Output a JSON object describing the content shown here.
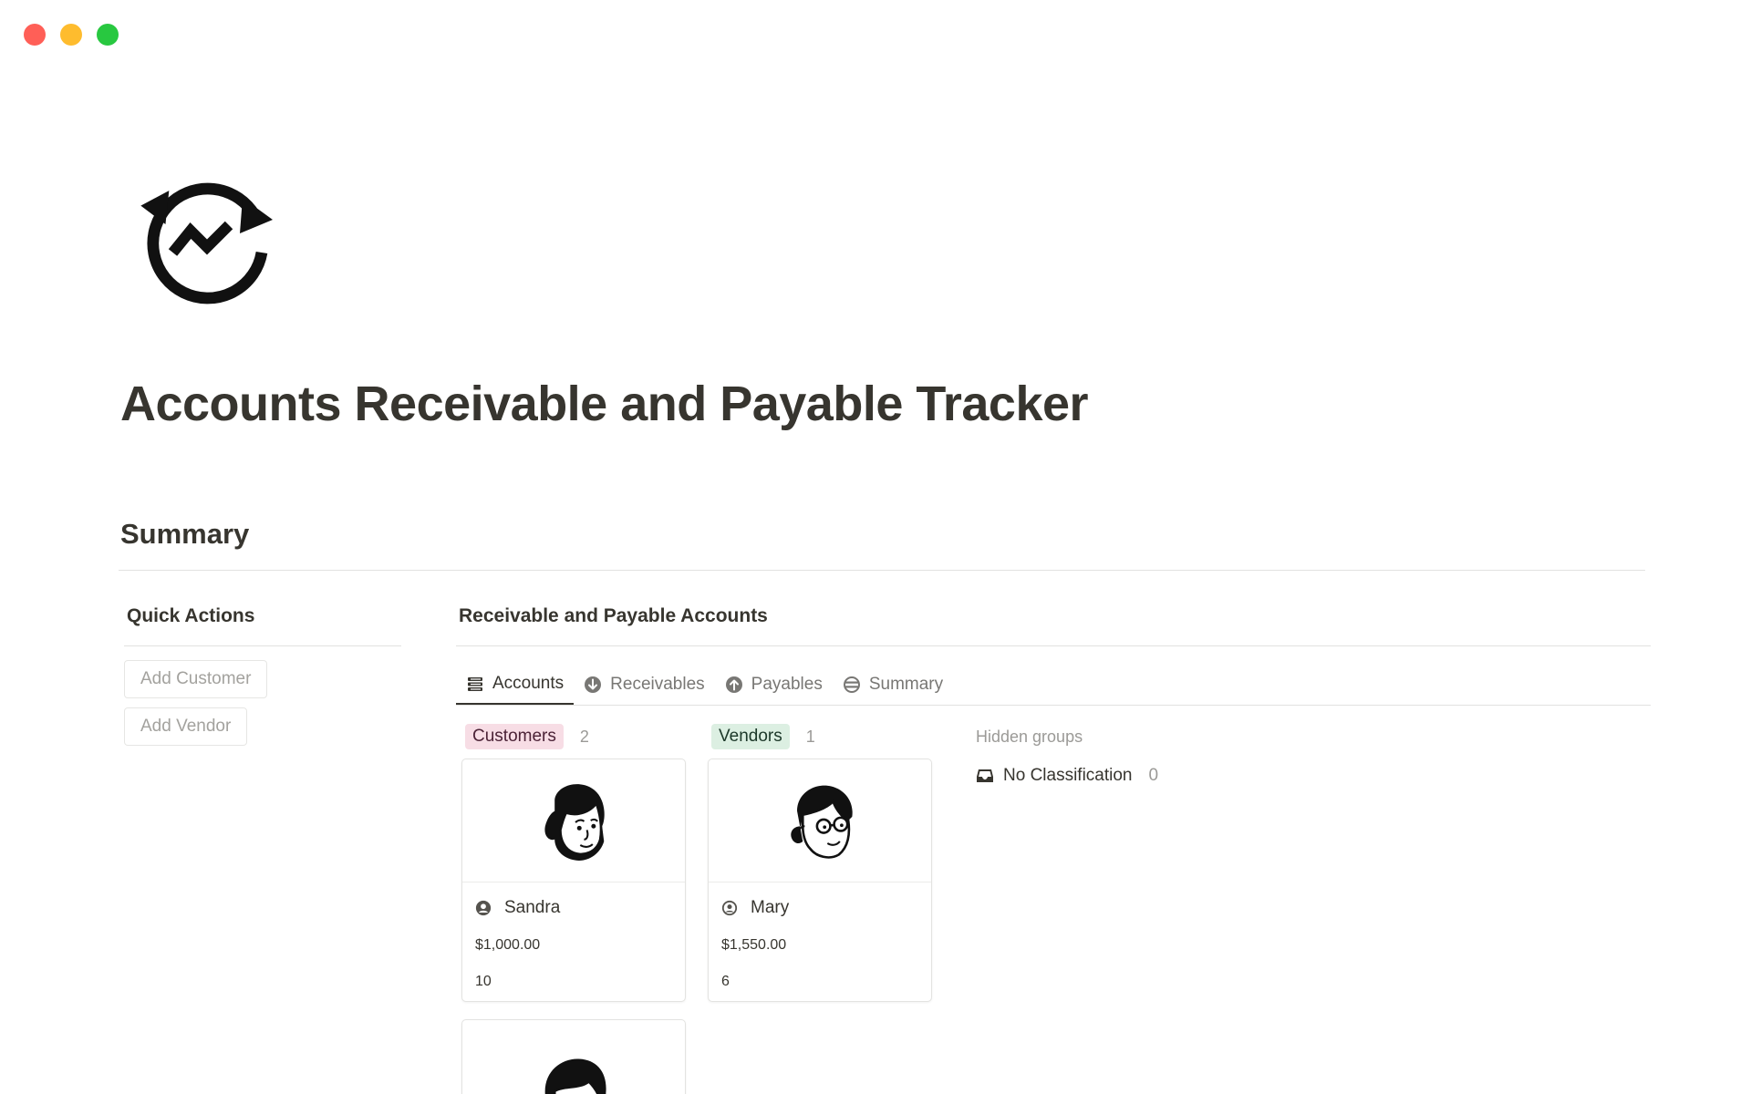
{
  "window": {
    "controls": [
      "close",
      "minimize",
      "maximize"
    ]
  },
  "page": {
    "icon": "exchange-arrows-chart-icon",
    "title": "Accounts Receivable and Payable Tracker"
  },
  "summary": {
    "heading": "Summary"
  },
  "quick_actions": {
    "title": "Quick Actions",
    "buttons": [
      "Add Customer",
      "Add Vendor"
    ]
  },
  "database": {
    "title": "Receivable and Payable Accounts",
    "tabs": [
      {
        "label": "Accounts",
        "icon": "table-icon",
        "active": true
      },
      {
        "label": "Receivables",
        "icon": "arrow-down-circle-icon",
        "active": false
      },
      {
        "label": "Payables",
        "icon": "arrow-up-circle-icon",
        "active": false
      },
      {
        "label": "Summary",
        "icon": "equals-circle-icon",
        "active": false
      }
    ],
    "groups": [
      {
        "label": "Customers",
        "count": "2",
        "color": "#f7dde5",
        "cards": [
          {
            "name": "Sandra",
            "amount": "$1,000.00",
            "number": "10",
            "avatar": "woman-avatar-icon"
          },
          {
            "name": "",
            "amount": "",
            "number": "",
            "avatar": "man-glasses-avatar-icon"
          }
        ]
      },
      {
        "label": "Vendors",
        "count": "1",
        "color": "#dcefe2",
        "cards": [
          {
            "name": "Mary",
            "amount": "$1,550.00",
            "number": "6",
            "avatar": "woman-glasses-avatar-icon"
          }
        ]
      }
    ],
    "hidden_groups": {
      "label": "Hidden groups",
      "items": [
        {
          "label": "No Classification",
          "count": "0",
          "icon": "inbox-icon"
        }
      ]
    }
  }
}
